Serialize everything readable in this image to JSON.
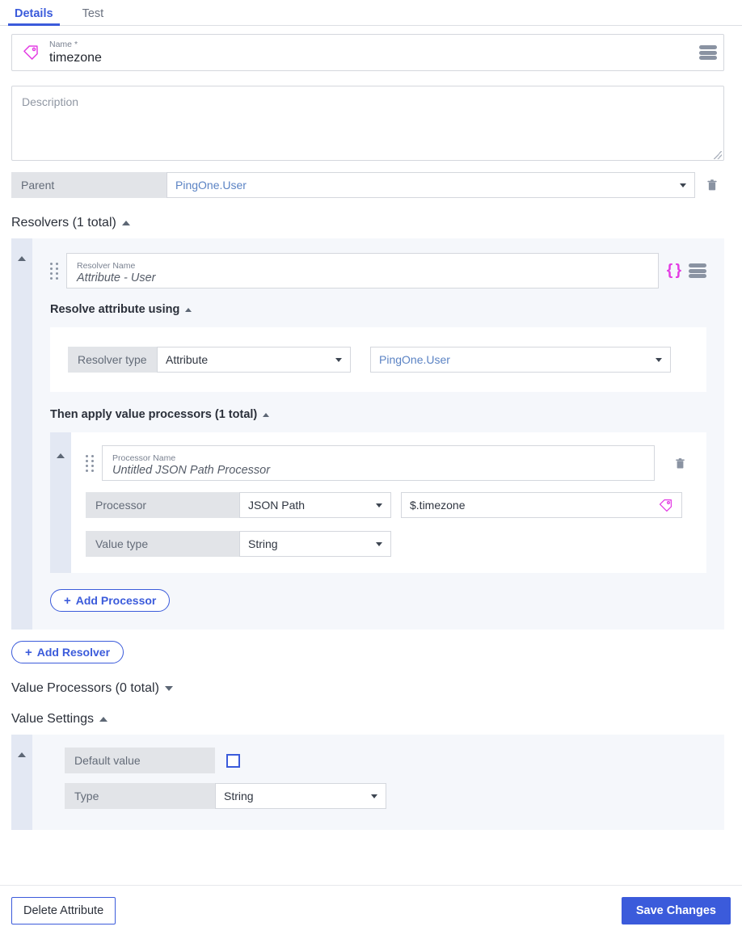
{
  "tabs": [
    {
      "label": "Details",
      "active": true
    },
    {
      "label": "Test",
      "active": false
    }
  ],
  "name_field": {
    "label": "Name",
    "required_marker": "*",
    "value": "timezone",
    "icon": "tag-icon",
    "menu_icon": "hamburger-menu-icon"
  },
  "description": {
    "placeholder": "Description",
    "value": ""
  },
  "parent": {
    "label": "Parent",
    "value": "PingOne.User",
    "delete_icon": "trash-icon"
  },
  "resolvers_section": {
    "heading": "Resolvers (1 total)",
    "collapsed": false,
    "resolver": {
      "name_caption": "Resolver Name",
      "name_value": "Attribute - User",
      "brace_icon": "curly-braces-icon",
      "menu_icon": "hamburger-menu-icon",
      "resolve_using_heading": "Resolve attribute using",
      "resolver_type_label": "Resolver type",
      "resolver_type_value": "Attribute",
      "resolver_source_value": "PingOne.User",
      "processors_heading": "Then apply value processors (1 total)",
      "processor": {
        "name_caption": "Processor Name",
        "name_value": "Untitled JSON Path Processor",
        "delete_icon": "trash-icon",
        "processor_label": "Processor",
        "processor_value": "JSON Path",
        "expression_value": "$.timezone",
        "expression_icon": "tag-icon",
        "value_type_label": "Value type",
        "value_type_value": "String"
      },
      "add_processor_label": "Add Processor"
    },
    "add_resolver_label": "Add Resolver"
  },
  "value_processors_section": {
    "heading": "Value Processors (0 total)",
    "collapsed": true
  },
  "value_settings_section": {
    "heading": "Value Settings",
    "collapsed": false,
    "default_value_label": "Default value",
    "default_value_checked": false,
    "type_label": "Type",
    "type_value": "String"
  },
  "footer": {
    "delete_label": "Delete Attribute",
    "save_label": "Save Changes"
  },
  "colors": {
    "accent": "#3b5bdb",
    "link": "#5b83c4",
    "magenta": "#e33ce3",
    "label_bg": "#e2e4e8",
    "card_bg": "#f5f7fb",
    "rail_bg": "#e3e8f3"
  }
}
